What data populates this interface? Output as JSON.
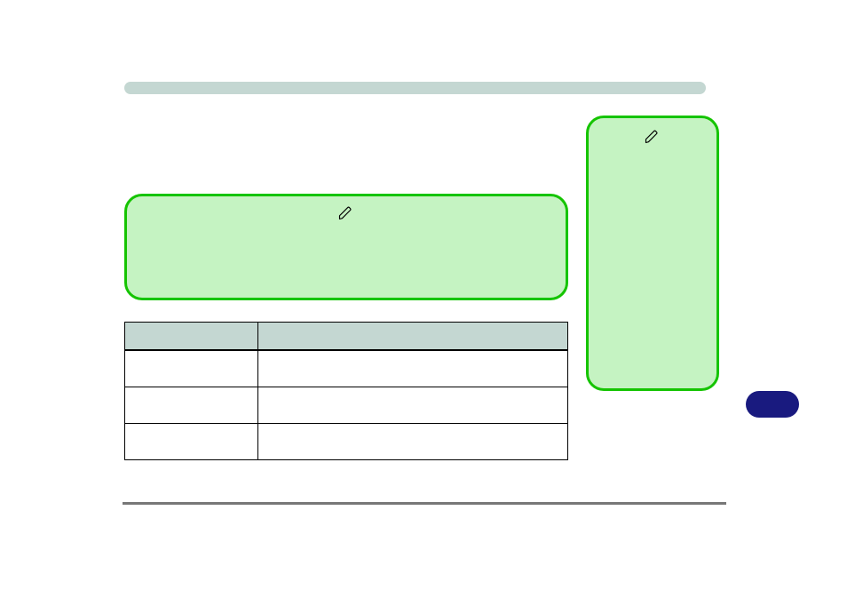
{
  "heading": "",
  "notes": {
    "wide": {
      "text": ""
    },
    "tall": {
      "text": ""
    }
  },
  "table": {
    "headers": [
      "",
      ""
    ],
    "rows": [
      [
        "",
        ""
      ],
      [
        "",
        ""
      ],
      [
        "",
        ""
      ]
    ]
  },
  "pill_label": "",
  "icons": {
    "pen": "pen-icon"
  },
  "colors": {
    "note_fill": "#c5f3c2",
    "note_border": "#15c400",
    "bar": "#c4d7d2",
    "pill": "#191a7f"
  }
}
